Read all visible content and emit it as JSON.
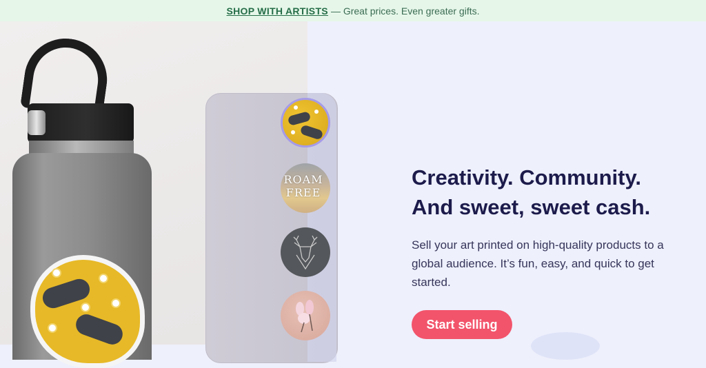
{
  "banner": {
    "link_label": "SHOP WITH ARTISTS",
    "message": "— Great prices. Even greater gifts."
  },
  "product_options": [
    {
      "name": "badger-sticker",
      "selected": true
    },
    {
      "name": "roam-free-sticker",
      "text": "ROAM FREE",
      "selected": false
    },
    {
      "name": "deer-sticker",
      "selected": false
    },
    {
      "name": "magnolia-sticker",
      "selected": false
    }
  ],
  "hero": {
    "headline_line1": "Creativity. Community.",
    "headline_line2": "And sweet, sweet cash.",
    "description": "Sell your art printed on high-quality products to a global audience. It’s fun, easy, and quick to get started.",
    "cta_label": "Start selling"
  },
  "colors": {
    "banner_bg": "#e6f7e9",
    "banner_link": "#256d48",
    "right_panel_bg": "#eef0fc",
    "headline": "#1c1b4b",
    "cta_bg": "#f2546b",
    "selected_ring": "#a59be8"
  },
  "icons": [
    "deer-icon",
    "magnolia-icon",
    "flower-icon",
    "badger-illustration"
  ]
}
